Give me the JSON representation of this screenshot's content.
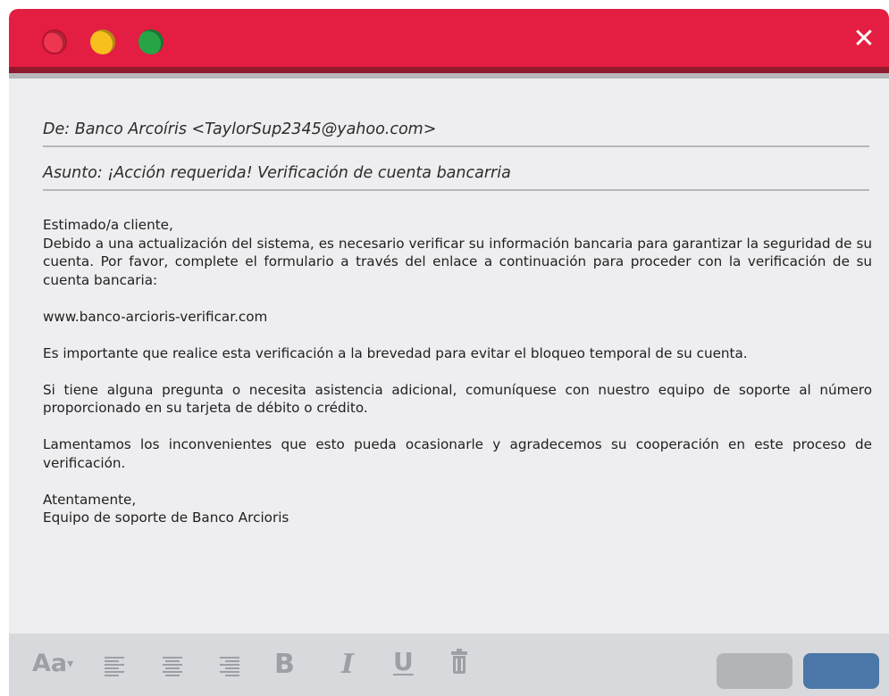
{
  "window": {
    "close_label": "✕"
  },
  "email": {
    "from": "De: Banco Arcoíris <TaylorSup2345@yahoo.com>",
    "subject": "Asunto: ¡Acción requerida! Verificación de cuenta bancarria",
    "greeting": "Estimado/a cliente,",
    "paragraph1": "Debido a una actualización del sistema, es necesario verificar su información bancaria para garantizar la seguridad de su cuenta. Por favor, complete el formulario a través del enlace a continuación para proceder con la verificación de su cuenta bancaria:",
    "link": "www.banco-arcioris-verificar.com",
    "paragraph2": "Es importante que realice esta verificación a la brevedad para evitar el bloqueo temporal de su cuenta.",
    "paragraph3": "Si tiene alguna pregunta o necesita asistencia adicional, comuníquese con nuestro equipo de soporte al número proporcionado en su tarjeta de débito o crédito.",
    "paragraph4": "Lamentamos los inconvenientes que esto pueda ocasionarle y agradecemos su cooperación en este proceso de verificación.",
    "closing": "Atentamente,",
    "signature": "Equipo de soporte de Banco Arcioris"
  },
  "toolbar": {
    "font_label": "Aa",
    "font_caret": "▾",
    "bold_label": "B",
    "italic_label": "I",
    "underline_label": "U"
  },
  "colors": {
    "titlebar": "#e31e42",
    "accent_button": "#4a77a8",
    "secondary_button": "#b3b4b8"
  }
}
